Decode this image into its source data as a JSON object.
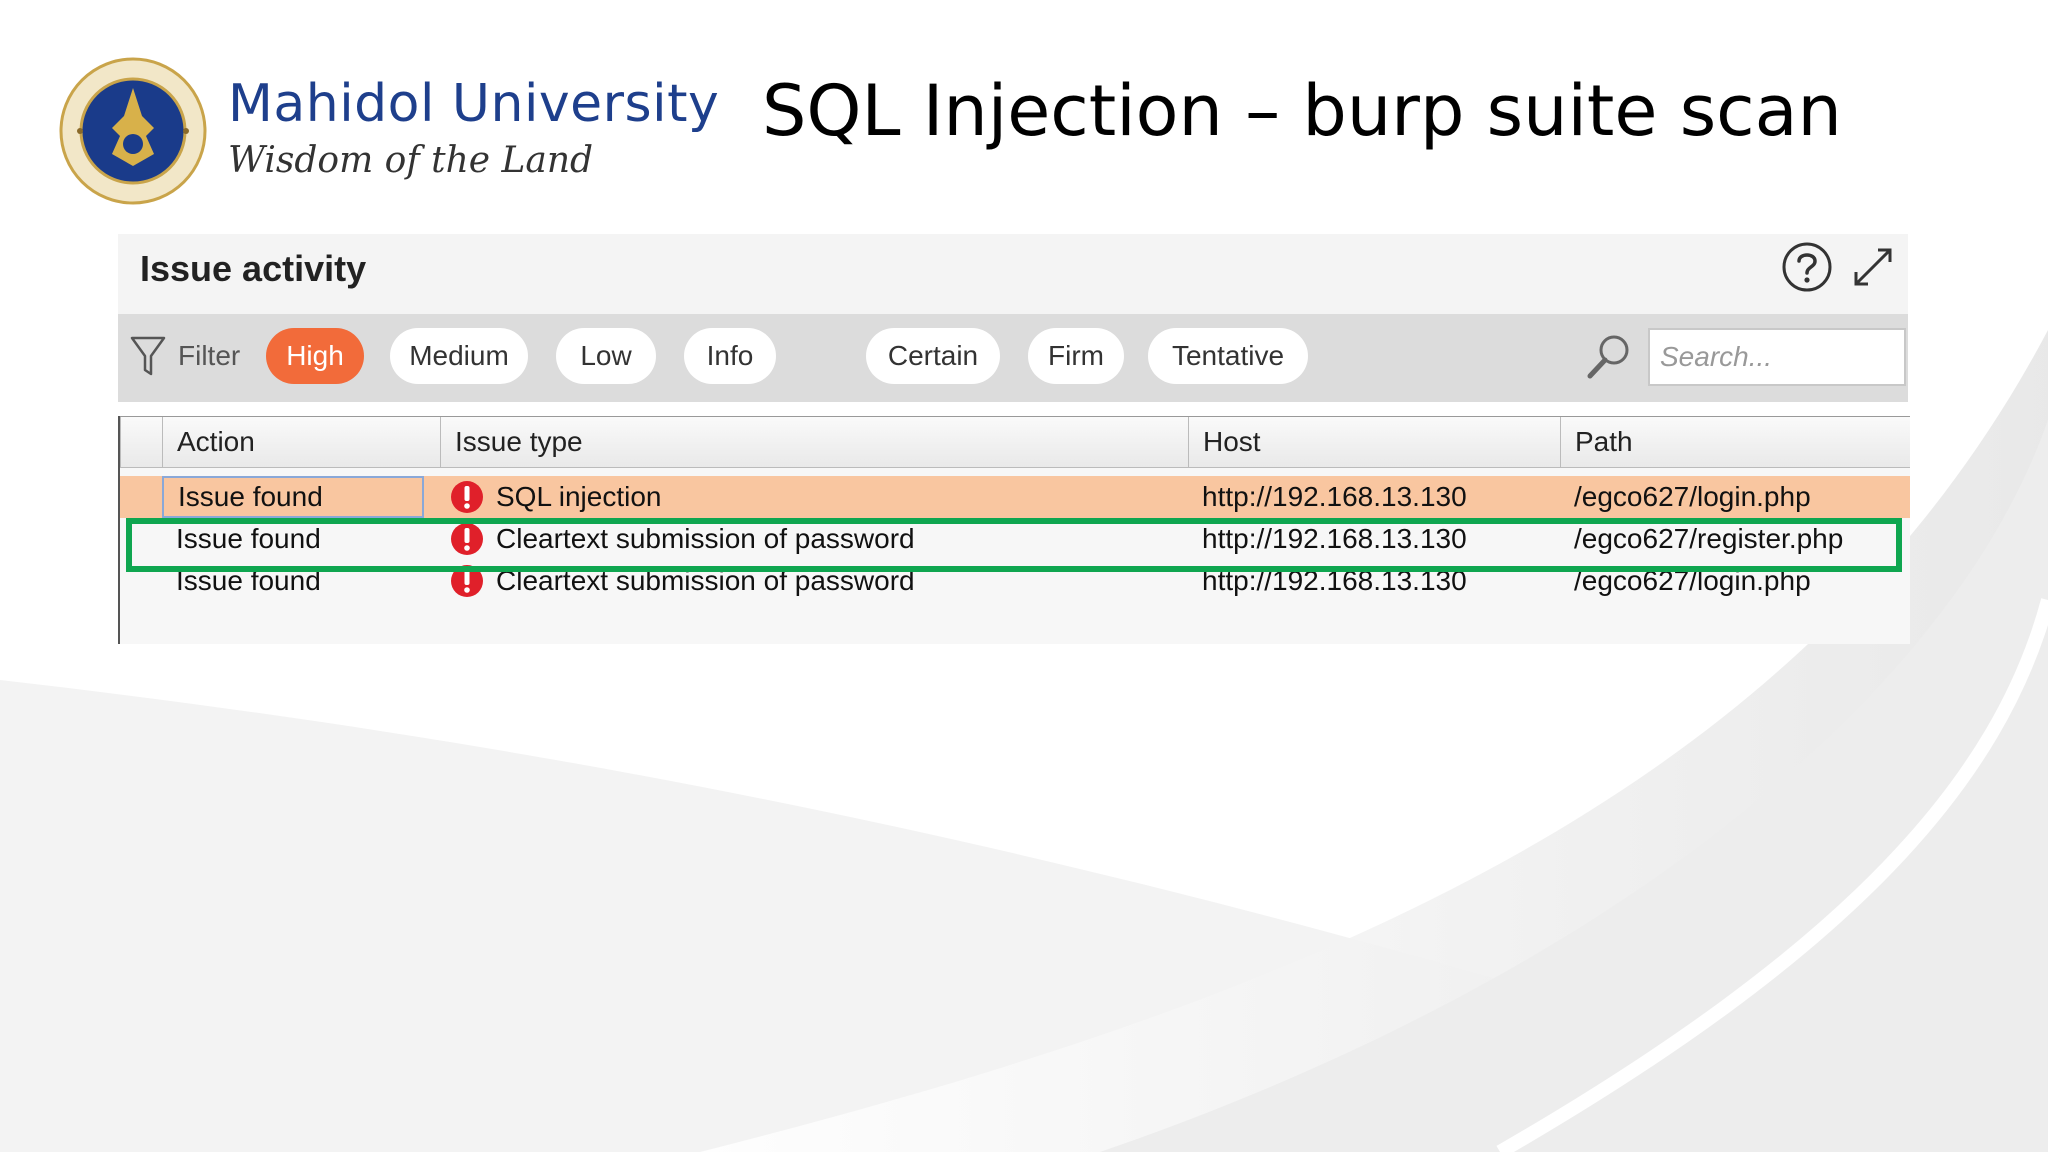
{
  "slide": {
    "title": "SQL Injection – burp suite scan",
    "brand_name": "Mahidol University",
    "brand_motto": "Wisdom of the Land"
  },
  "panel": {
    "title": "Issue activity",
    "filter_label": "Filter",
    "severity_filters": [
      "High",
      "Medium",
      "Low",
      "Info"
    ],
    "confidence_filters": [
      "Certain",
      "Firm",
      "Tentative"
    ],
    "active_filter": "High",
    "search_placeholder": "Search..."
  },
  "table": {
    "columns": [
      "Action",
      "Issue type",
      "Host",
      "Path"
    ],
    "rows": [
      {
        "action": "Issue found",
        "issue_type": "SQL injection",
        "host": "http://192.168.13.130",
        "path": "/egco627/login.php",
        "selected": true
      },
      {
        "action": "Issue found",
        "issue_type": "Cleartext submission of password",
        "host": "http://192.168.13.130",
        "path": "/egco627/register.php",
        "selected": false
      },
      {
        "action": "Issue found",
        "issue_type": "Cleartext submission of password",
        "host": "http://192.168.13.130",
        "path": "/egco627/login.php",
        "selected": false
      }
    ]
  },
  "colors": {
    "active_chip": "#f26b3a",
    "selected_row": "#f9c6a0",
    "highlight_border": "#0fa650",
    "severity_icon": "#e0202a",
    "brand": "#1e3f8c"
  },
  "icons": {
    "filter": "funnel-icon",
    "help": "question-circle-icon",
    "expand": "expand-arrows-icon",
    "search": "magnifier-icon",
    "severity": "exclamation-circle-icon"
  }
}
